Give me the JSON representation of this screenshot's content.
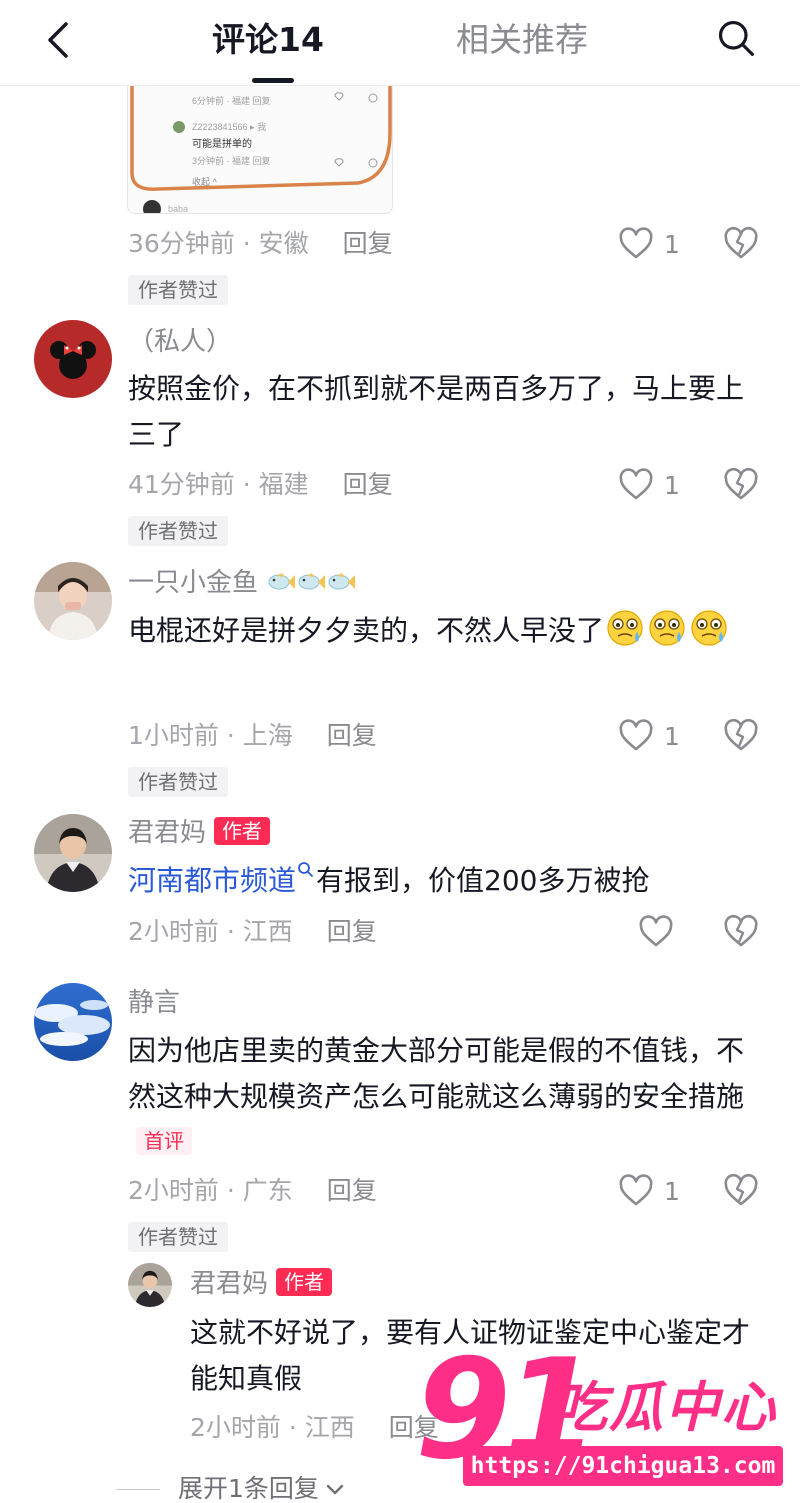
{
  "header": {
    "tab_comments": "评论14",
    "tab_related": "相关推荐"
  },
  "thumbnail": {
    "line1_meta": "6分钟前 · 福建    回复",
    "line2_user": "Z2223841566 ▸ 我",
    "line3_text": "可能是拼单的",
    "line4_meta": "3分钟前 · 福建    回复",
    "line5_collapse": "收起 ^",
    "line6_user": "baba"
  },
  "comments": [
    {
      "meta_time": "36分钟前 · 安徽",
      "reply_label": "回复",
      "likes": "1",
      "author_liked": "作者赞过"
    },
    {
      "username": "（私人）",
      "text": "按照金价，在不抓到就不是两百多万了，马上要上三了",
      "meta_time": "41分钟前 · 福建",
      "reply_label": "回复",
      "likes": "1",
      "author_liked": "作者赞过"
    },
    {
      "username": "一只小金鱼",
      "text": "电棍还好是拼夕夕卖的，不然人早没了",
      "meta_time": "1小时前 · 上海",
      "reply_label": "回复",
      "likes": "1",
      "author_liked": "作者赞过"
    },
    {
      "username": "君君妈",
      "author_badge": "作者",
      "mention": "河南都市频道",
      "text": "有报到，价值200多万被抢",
      "meta_time": "2小时前 · 江西",
      "reply_label": "回复"
    },
    {
      "username": "静言",
      "text": "因为他店里卖的黄金大部分可能是假的不值钱，不然这种大规模资产怎么可能就这么薄弱的安全措施",
      "first_badge": "首评",
      "meta_time": "2小时前 · 广东",
      "reply_label": "回复",
      "likes": "1",
      "author_liked": "作者赞过"
    }
  ],
  "reply": {
    "username": "君君妈",
    "author_badge": "作者",
    "text": "这就不好说了，要有人证物证鉴定中心鉴定才能知真假",
    "meta_time": "2小时前 · 江西",
    "reply_label": "回复"
  },
  "expand_label": "展开1条回复",
  "watermark": {
    "number": "91",
    "name": "吃瓜中心",
    "url": "https://91chigua13.com"
  },
  "colors": {
    "accent": "#fe2c55",
    "mention": "#2a5ad8",
    "watermark": "#ff2f87"
  }
}
